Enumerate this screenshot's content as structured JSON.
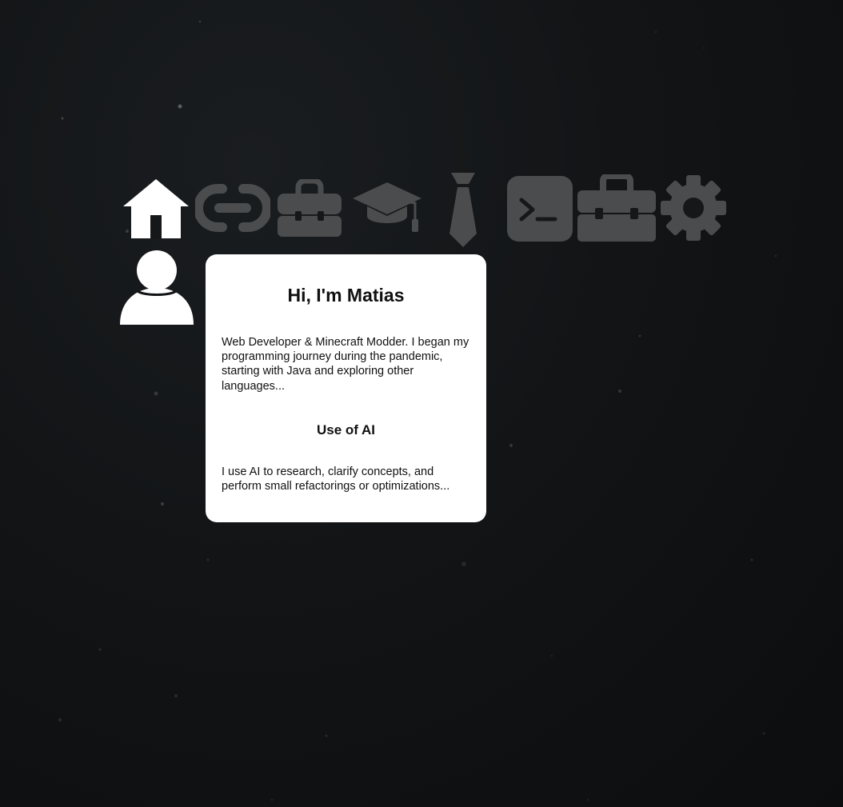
{
  "nav": {
    "items": [
      {
        "icon": "home-icon",
        "active": true
      },
      {
        "icon": "link-icon",
        "active": false
      },
      {
        "icon": "briefcase-icon",
        "active": false
      },
      {
        "icon": "graduation-cap-icon",
        "active": false
      },
      {
        "icon": "tie-icon",
        "active": false
      },
      {
        "icon": "terminal-icon",
        "active": false
      },
      {
        "icon": "toolbox-icon",
        "active": false
      },
      {
        "icon": "gear-icon",
        "active": false
      }
    ],
    "active_color": "#ffffff",
    "inactive_color": "#4a4c4e"
  },
  "profile": {
    "avatar_icon": "user-icon"
  },
  "about": {
    "title": "Hi, I'm Matias",
    "intro": "Web Developer & Minecraft Modder. I began my programming journey during the pandemic, starting with Java and exploring other languages...",
    "ai_heading": "Use of AI",
    "ai_text": "I use AI to research, clarify concepts, and perform small refactorings or optimizations..."
  }
}
